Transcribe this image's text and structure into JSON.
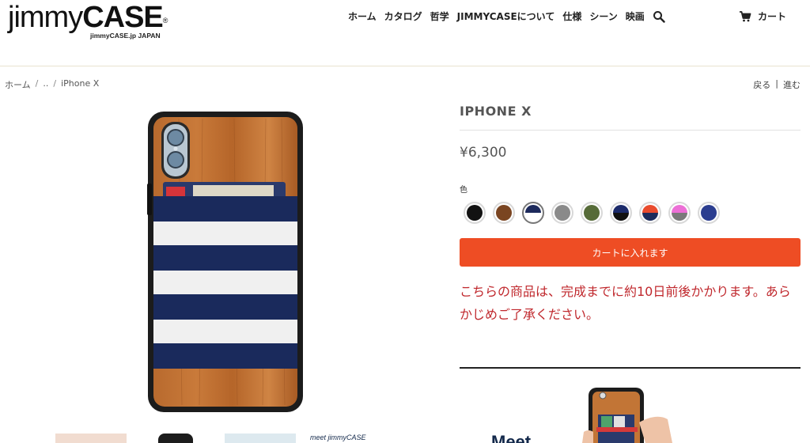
{
  "header": {
    "logo": {
      "main_left": "jimmy",
      "main_right": "CASE",
      "registered": "®",
      "sub": "jimmyCASE.jp JAPAN"
    },
    "nav": [
      {
        "label": "ホーム"
      },
      {
        "label": "カタログ"
      },
      {
        "label": "哲学"
      },
      {
        "label": "JIMMYCASEについて"
      },
      {
        "label": "仕様"
      },
      {
        "label": "シーン"
      },
      {
        "label": "映画"
      }
    ],
    "search_icon": "search-icon",
    "cart": {
      "label": "カート",
      "icon": "cart-icon"
    }
  },
  "breadcrumb": {
    "items": [
      "ホーム",
      "..",
      "iPhone X"
    ],
    "separator": "/"
  },
  "pager": {
    "back": "戻る",
    "sep": "|",
    "next": "進む"
  },
  "product": {
    "title": "IPHONE X",
    "price": "¥6,300",
    "color_label": "色",
    "swatches": [
      {
        "top": "#121212",
        "bottom": "#121212",
        "selected": false
      },
      {
        "top": "#7a4521",
        "bottom": "#7a4521",
        "selected": false
      },
      {
        "top": "#1d2a5c",
        "bottom": "#ffffff",
        "selected": true
      },
      {
        "top": "#8a8a8a",
        "bottom": "#8a8a8a",
        "selected": false
      },
      {
        "top": "#566b38",
        "bottom": "#566b38",
        "selected": false
      },
      {
        "top": "#1b2a6a",
        "bottom": "#111111",
        "selected": false
      },
      {
        "top": "#e94b2d",
        "bottom": "#1c2c5c",
        "selected": false
      },
      {
        "top": "#ec6fd6",
        "bottom": "#7a7a7a",
        "selected": false
      },
      {
        "top": "#2b3d8f",
        "bottom": "#2b3d8f",
        "selected": false
      }
    ],
    "add_to_cart": "カートに入れます",
    "notice": "こちらの商品は、完成までに約10日前後かかります。あらかじめご了承ください。"
  },
  "thumbs": {
    "meet_label": "meet jimmyCASE"
  },
  "promo": {
    "text": "Meet"
  },
  "colors": {
    "accent": "#ee4d24",
    "notice_text": "#c0282d",
    "header_border": "#e8e3cf"
  }
}
